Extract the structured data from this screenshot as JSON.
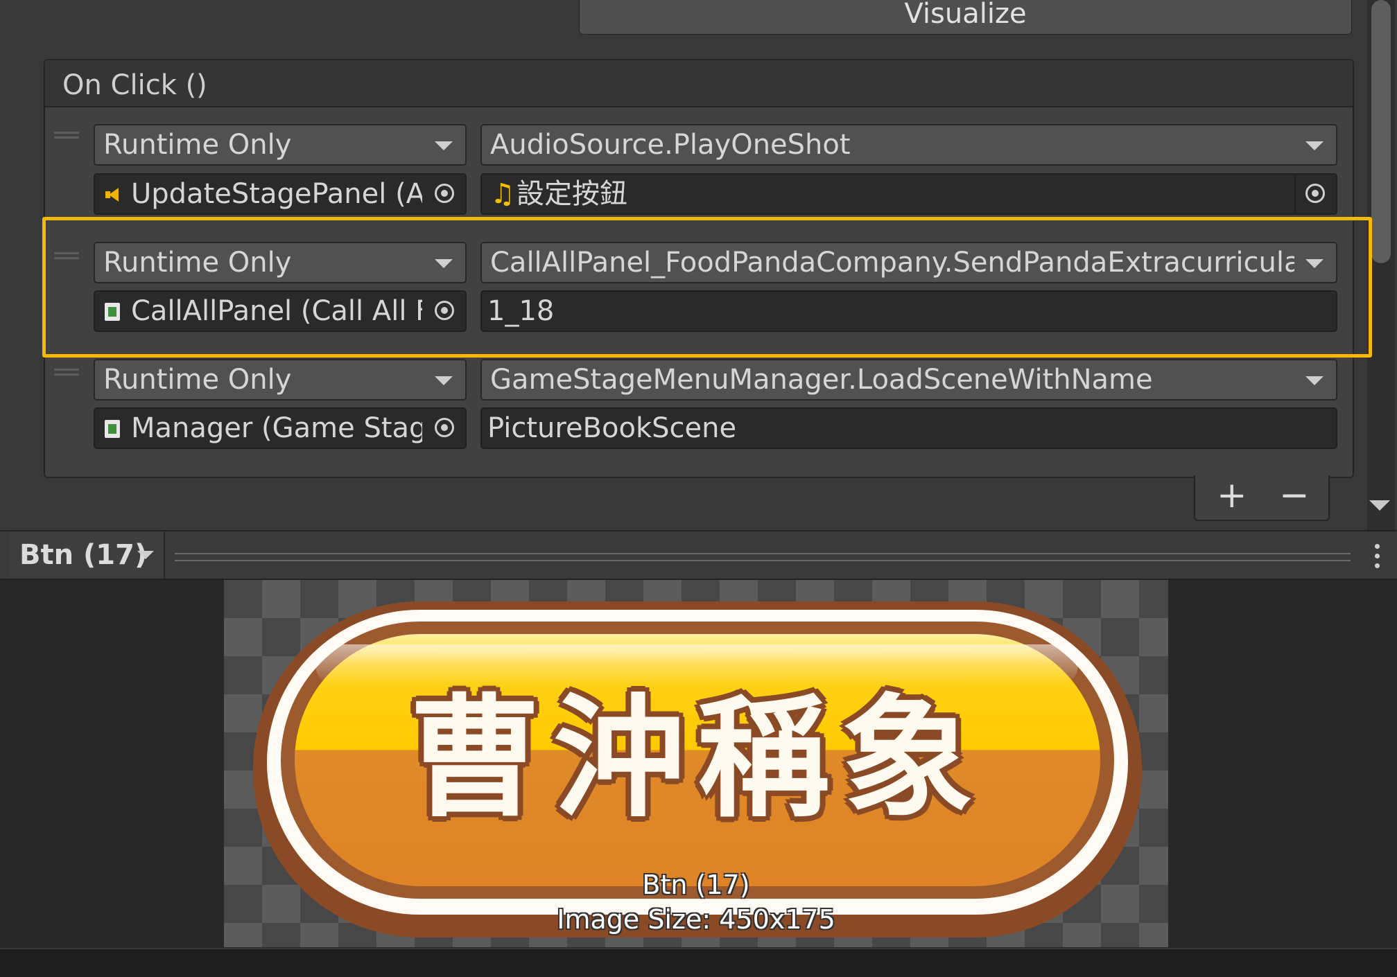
{
  "visualize_button": "Visualize",
  "event": {
    "title": "On Click ()",
    "entries": [
      {
        "call_state": "Runtime Only",
        "function": "AudioSource.PlayOneShot",
        "target": "UpdateStagePanel (A",
        "target_icon": "audio-source-icon",
        "argument": "設定按鈕",
        "argument_icon": "audio-clip-icon",
        "argument_is_object": true
      },
      {
        "call_state": "Runtime Only",
        "function": "CallAllPanel_FoodPandaCompany.SendPandaExtracurricular",
        "target": "CallAllPanel (Call All F",
        "target_icon": "script-icon",
        "argument": "1_18",
        "argument_is_object": false,
        "highlighted": true
      },
      {
        "call_state": "Runtime Only",
        "function": "GameStageMenuManager.LoadSceneWithName",
        "target": "Manager (Game Stage",
        "target_icon": "script-icon",
        "argument": "PictureBookScene",
        "argument_is_object": false
      }
    ],
    "add_label": "+",
    "remove_label": "−"
  },
  "preview": {
    "selector": "Btn (17)",
    "sprite_text": "曹沖稱象",
    "image_name": "Btn (17)",
    "image_size": "Image Size: 450x175"
  },
  "colors": {
    "highlight": "#f6b800",
    "button_yellow": "#ffca00",
    "button_orange": "#e08a28",
    "button_border": "#8a4a26"
  }
}
